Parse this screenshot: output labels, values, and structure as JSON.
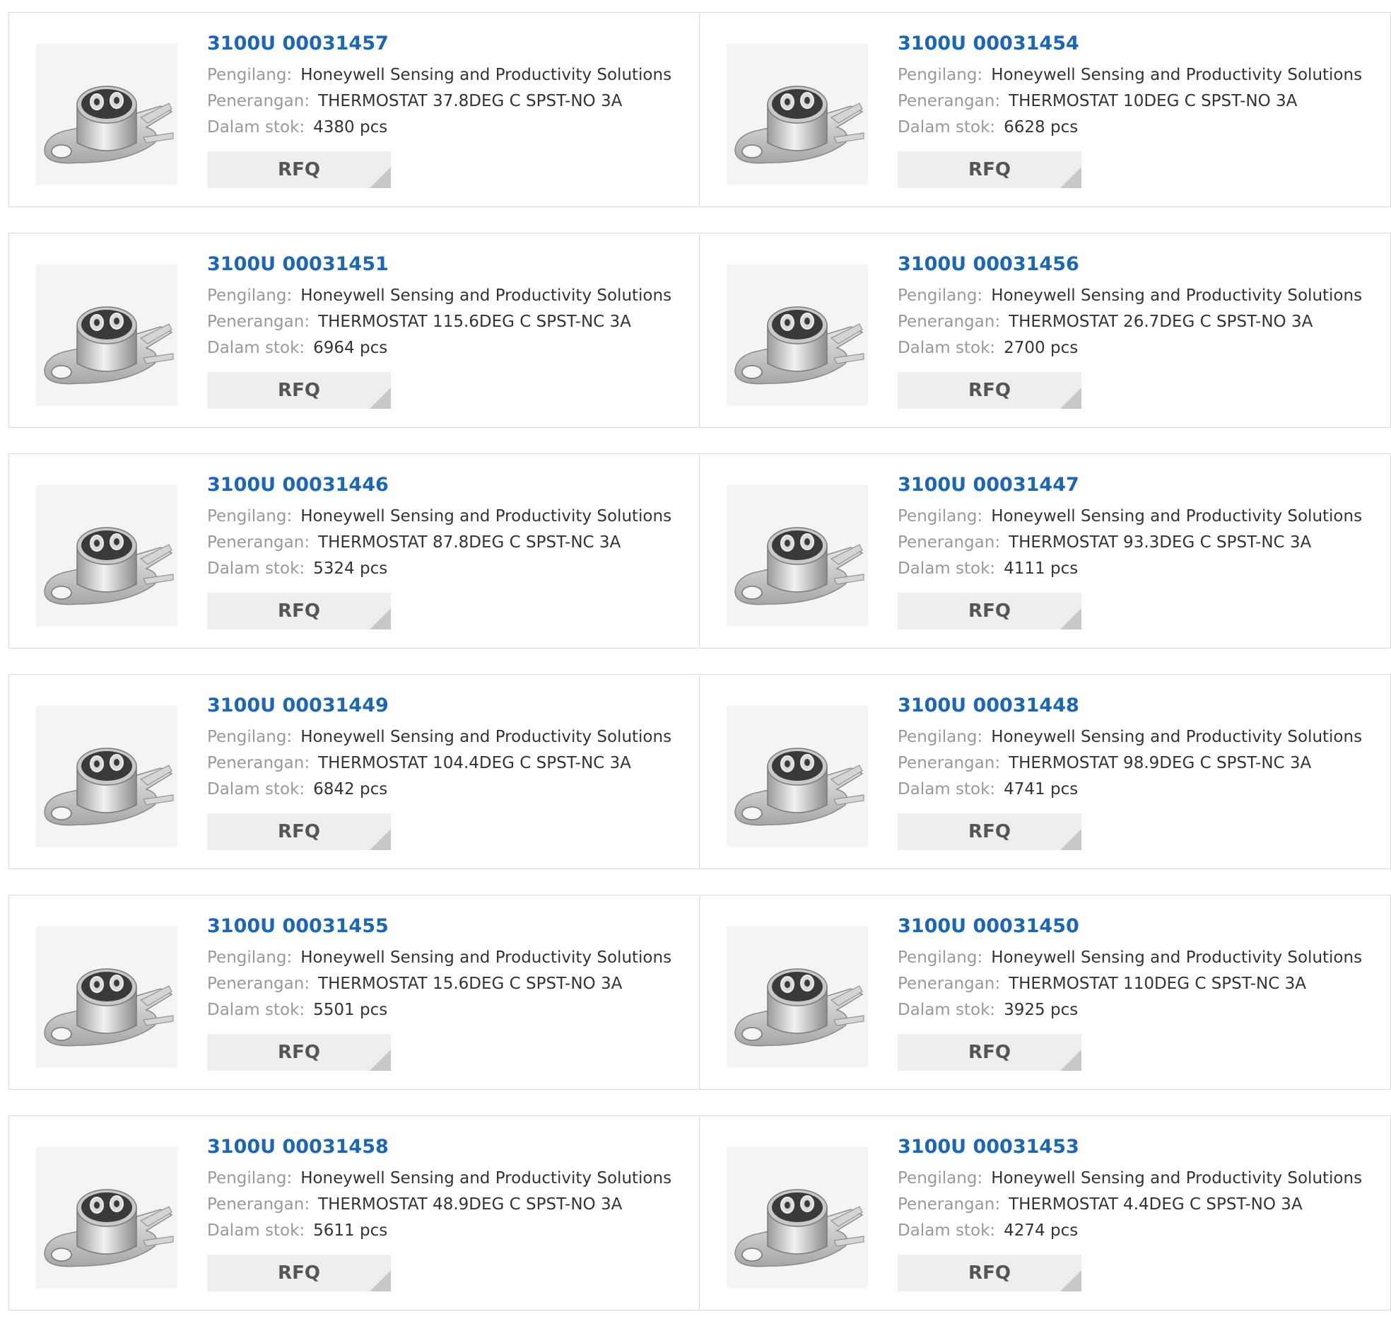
{
  "labels": {
    "manufacturer": "Pengilang:",
    "description": "Penerangan:",
    "stock": "Dalam stok:",
    "rfq": "RFQ"
  },
  "products": [
    {
      "part": "3100U 00031457",
      "manufacturer": "Honeywell Sensing and Productivity Solutions",
      "description": "THERMOSTAT 37.8DEG C SPST-NO 3A",
      "stock": "4380 pcs"
    },
    {
      "part": "3100U 00031454",
      "manufacturer": "Honeywell Sensing and Productivity Solutions",
      "description": "THERMOSTAT 10DEG C SPST-NO 3A",
      "stock": "6628 pcs"
    },
    {
      "part": "3100U 00031451",
      "manufacturer": "Honeywell Sensing and Productivity Solutions",
      "description": "THERMOSTAT 115.6DEG C SPST-NC 3A",
      "stock": "6964 pcs"
    },
    {
      "part": "3100U 00031456",
      "manufacturer": "Honeywell Sensing and Productivity Solutions",
      "description": "THERMOSTAT 26.7DEG C SPST-NO 3A",
      "stock": "2700 pcs"
    },
    {
      "part": "3100U 00031446",
      "manufacturer": "Honeywell Sensing and Productivity Solutions",
      "description": "THERMOSTAT 87.8DEG C SPST-NC 3A",
      "stock": "5324 pcs"
    },
    {
      "part": "3100U 00031447",
      "manufacturer": "Honeywell Sensing and Productivity Solutions",
      "description": "THERMOSTAT 93.3DEG C SPST-NC 3A",
      "stock": "4111 pcs"
    },
    {
      "part": "3100U 00031449",
      "manufacturer": "Honeywell Sensing and Productivity Solutions",
      "description": "THERMOSTAT 104.4DEG C SPST-NC 3A",
      "stock": "6842 pcs"
    },
    {
      "part": "3100U 00031448",
      "manufacturer": "Honeywell Sensing and Productivity Solutions",
      "description": "THERMOSTAT 98.9DEG C SPST-NC 3A",
      "stock": "4741 pcs"
    },
    {
      "part": "3100U 00031455",
      "manufacturer": "Honeywell Sensing and Productivity Solutions",
      "description": "THERMOSTAT 15.6DEG C SPST-NO 3A",
      "stock": "5501 pcs"
    },
    {
      "part": "3100U 00031450",
      "manufacturer": "Honeywell Sensing and Productivity Solutions",
      "description": "THERMOSTAT 110DEG C SPST-NC 3A",
      "stock": "3925 pcs"
    },
    {
      "part": "3100U 00031458",
      "manufacturer": "Honeywell Sensing and Productivity Solutions",
      "description": "THERMOSTAT 48.9DEG C SPST-NO 3A",
      "stock": "5611 pcs"
    },
    {
      "part": "3100U 00031453",
      "manufacturer": "Honeywell Sensing and Productivity Solutions",
      "description": "THERMOSTAT 4.4DEG C SPST-NO 3A",
      "stock": "4274 pcs"
    }
  ],
  "colors": {
    "title": "#1a67b8",
    "label": "#999999",
    "value": "#333333",
    "rfq_bg": "#eeeeee"
  },
  "icons": {
    "product_image": "thermostat-image-icon"
  }
}
